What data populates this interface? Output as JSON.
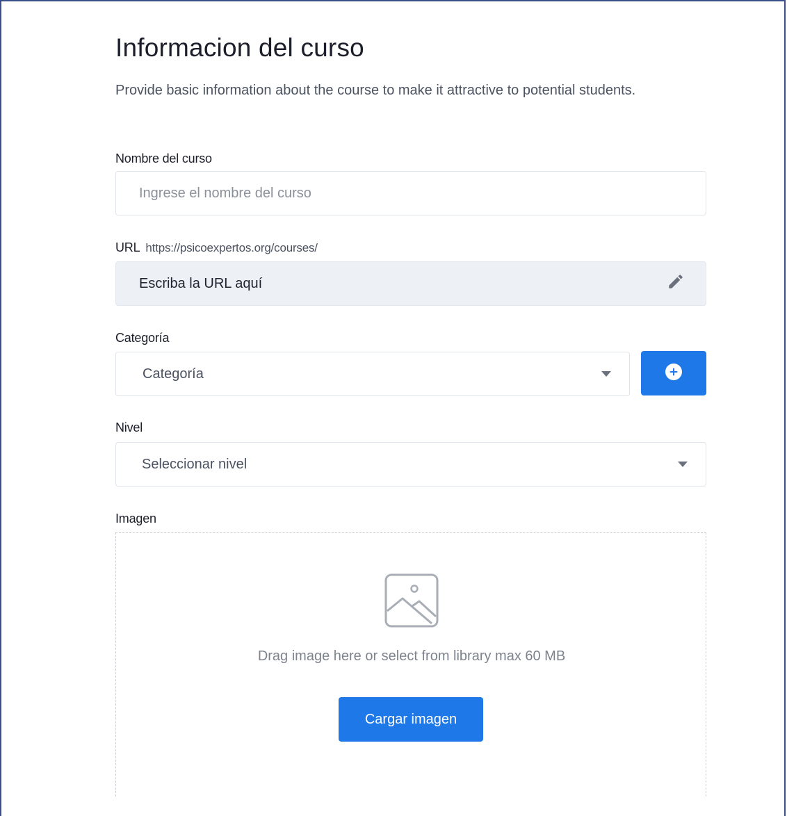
{
  "form": {
    "title": "Informacion del curso",
    "subtitle": "Provide basic information about the course to make it attractive to potential students.",
    "course_name": {
      "label": "Nombre del curso",
      "placeholder": "Ingrese el nombre del curso"
    },
    "url": {
      "label": "URL",
      "prefix": "https://psicoexpertos.org/courses/",
      "placeholder": "Escriba la URL aquí",
      "icon": "pencil-icon"
    },
    "category": {
      "label": "Categoría",
      "selected": "Categoría",
      "add_icon": "plus-circle-icon"
    },
    "level": {
      "label": "Nivel",
      "selected": "Seleccionar nivel"
    },
    "image": {
      "label": "Imagen",
      "drop_text": "Drag image here or select from library max 60 MB",
      "upload_label": "Cargar imagen",
      "icon": "image-placeholder-icon"
    }
  },
  "colors": {
    "accent": "#1f78e8",
    "url_field_bg": "#edf0f5",
    "frame_border": "#3a4f8a"
  }
}
